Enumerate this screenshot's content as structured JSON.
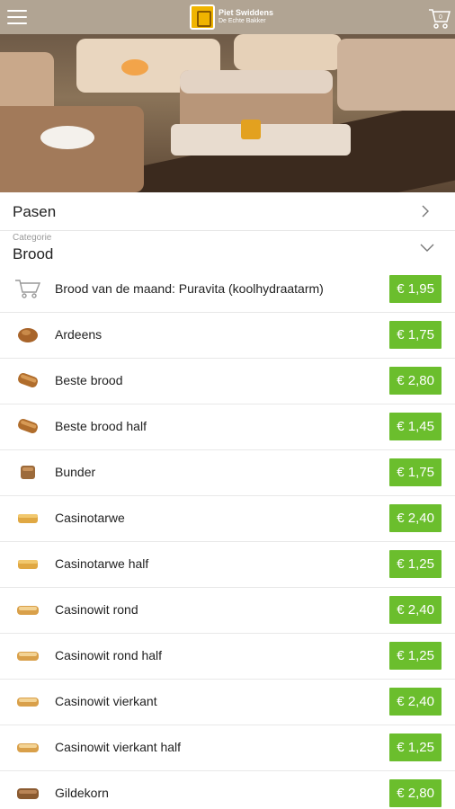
{
  "header": {
    "menu_icon": "hamburger-icon",
    "logo_line1": "Piet Swiddens",
    "logo_line2": "De Echte Bakker",
    "cart_icon": "cart-icon",
    "cart_count": "0"
  },
  "section": {
    "title": "Pasen",
    "chevron_icon": "chevron-right-icon"
  },
  "category": {
    "label": "Categorie",
    "value": "Brood",
    "chevron_icon": "chevron-down-icon"
  },
  "products": [
    {
      "name": "Brood van de maand: Puravita (koolhydraatarm)",
      "price": "€ 1,95",
      "icon": "cart-outline-icon"
    },
    {
      "name": "Ardeens",
      "price": "€ 1,75",
      "icon": "round-bread-icon"
    },
    {
      "name": "Beste brood",
      "price": "€ 2,80",
      "icon": "loaf-icon"
    },
    {
      "name": "Beste brood half",
      "price": "€ 1,45",
      "icon": "loaf-icon"
    },
    {
      "name": "Bunder",
      "price": "€ 1,75",
      "icon": "square-bread-icon"
    },
    {
      "name": "Casinotarwe",
      "price": "€ 2,40",
      "icon": "tin-loaf-icon"
    },
    {
      "name": "Casinotarwe half",
      "price": "€ 1,25",
      "icon": "tin-loaf-icon"
    },
    {
      "name": "Casinowit rond",
      "price": "€ 2,40",
      "icon": "white-loaf-icon"
    },
    {
      "name": "Casinowit rond half",
      "price": "€ 1,25",
      "icon": "white-loaf-icon"
    },
    {
      "name": "Casinowit vierkant",
      "price": "€ 2,40",
      "icon": "white-loaf-icon"
    },
    {
      "name": "Casinowit vierkant half",
      "price": "€ 1,25",
      "icon": "white-loaf-icon"
    },
    {
      "name": "Gildekorn",
      "price": "€ 2,80",
      "icon": "grain-loaf-icon"
    }
  ],
  "colors": {
    "header_bg": "#b1a493",
    "price_green": "#6bbe2d"
  }
}
